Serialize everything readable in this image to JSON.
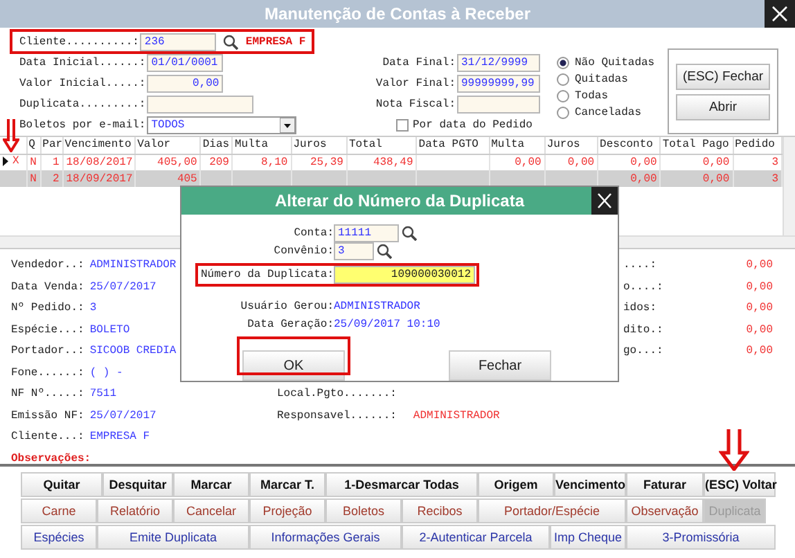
{
  "window": {
    "title": "Manutenção de Contas à Receber"
  },
  "filters": {
    "left": [
      {
        "label": "Cliente..........:",
        "value": "236",
        "kind": "search",
        "client_name": "EMPRESA F"
      },
      {
        "label": "Data Inicial......:",
        "value": "01/01/0001",
        "kind": "text"
      },
      {
        "label": "Valor Inicial.....:",
        "value": "0,00",
        "kind": "number"
      },
      {
        "label": "Duplicata.........:",
        "kind": "text"
      },
      {
        "label": "Boletos por e-mail:",
        "value": "TODOS",
        "kind": "select"
      }
    ],
    "right": [
      {
        "label": "Data Final:",
        "value": "31/12/9999"
      },
      {
        "label": "Valor Final:",
        "value": "99999999,99"
      },
      {
        "label": "Nota Fiscal:"
      }
    ],
    "checkbox": {
      "label": "Por data do Pedido",
      "checked": false
    },
    "radios": [
      {
        "label": "Não Quitadas",
        "selected": true
      },
      {
        "label": "Quitadas",
        "selected": false
      },
      {
        "label": "Todas",
        "selected": false
      },
      {
        "label": "Canceladas",
        "selected": false
      }
    ],
    "buttons": [
      "(ESC) Fechar",
      "Abrir"
    ]
  },
  "grid": {
    "columns": [
      null,
      "Q",
      "Par",
      "Vencimento",
      "Valor",
      "Dias",
      "Multa",
      "Juros",
      "Total",
      "Data PGTO",
      "Multa",
      "Juros",
      "Desconto",
      "Total Pago",
      "Pedido"
    ],
    "rows": [
      {
        "current": true,
        "selected": false,
        "cells": [
          "X",
          "N",
          "1",
          "18/08/2017",
          "405,00",
          "209",
          "8,10",
          "25,39",
          "438,49",
          null,
          "0,00",
          "0,00",
          "0,00",
          "0,00",
          "3"
        ]
      },
      {
        "current": false,
        "selected": true,
        "cells": [
          null,
          "N",
          "2",
          "18/09/2017",
          "405",
          null,
          null,
          null,
          null,
          null,
          null,
          null,
          "0,00",
          "0,00",
          "3"
        ]
      }
    ]
  },
  "details": {
    "left": [
      {
        "label": "Vendedor..:",
        "value": "ADMINISTRADOR",
        "kind": "field"
      },
      {
        "label": "Data Venda:",
        "value": "25/07/2017",
        "kind": "field"
      },
      {
        "label": "Nº Pedido.:",
        "value": "3",
        "kind": "field"
      },
      {
        "label": "Espécie...:",
        "value": "BOLETO",
        "kind": "field"
      },
      {
        "label": "Portador..:",
        "value": "SICOOB CREDIA",
        "kind": "field"
      },
      {
        "label": "Fone......:",
        "value": "(  )    -",
        "kind": "field"
      },
      {
        "label": "NF Nº.....:",
        "value": "7511",
        "kind": "field"
      },
      {
        "label": "Emissão NF:",
        "value": "25/07/2017",
        "kind": "field"
      },
      {
        "label": "Cliente...:",
        "value": "EMPRESA F",
        "kind": "field"
      },
      {
        "label": "Observações:",
        "kind": "note"
      }
    ],
    "middle": [
      {
        "label": "Local.Pgto.......:"
      },
      {
        "label": "Responsavel......:",
        "value": "ADMINISTRADOR"
      }
    ],
    "right": [
      {
        "label": "....:",
        "value": "0,00"
      },
      {
        "label": "o....:",
        "value": "0,00"
      },
      {
        "label": "idos:",
        "value": "0,00"
      },
      {
        "label": "dito.:",
        "value": "0,00"
      },
      {
        "label": "go...:",
        "value": "0,00"
      }
    ]
  },
  "actions": [
    {
      "kind": "primary",
      "buttons": [
        {
          "label": "Quitar",
          "disabled": false
        },
        {
          "label": "Desquitar",
          "disabled": false
        },
        {
          "label": "Marcar",
          "disabled": false
        },
        {
          "label": "Marcar T.",
          "disabled": false
        },
        {
          "label": "1-Desmarcar Todas",
          "disabled": false
        },
        {
          "label": "Origem",
          "disabled": false
        },
        {
          "label": "Vencimento",
          "disabled": false
        },
        {
          "label": "Faturar",
          "disabled": false
        },
        {
          "label": "(ESC) Voltar",
          "disabled": false
        }
      ]
    },
    {
      "kind": "secondary",
      "buttons": [
        {
          "label": "Carne",
          "disabled": false
        },
        {
          "label": "Relatório",
          "disabled": false
        },
        {
          "label": "Cancelar",
          "disabled": false
        },
        {
          "label": "Projeção",
          "disabled": false
        },
        {
          "label": "Boletos",
          "disabled": false
        },
        {
          "label": "Recibos",
          "disabled": false
        },
        {
          "label": "Portador/Espécie",
          "disabled": false
        },
        {
          "label": "Observação",
          "disabled": false
        },
        {
          "label": "Duplicata",
          "disabled": true
        }
      ]
    },
    {
      "kind": "tertiary",
      "buttons": [
        {
          "label": "Espécies",
          "disabled": false
        },
        {
          "label": "Emite Duplicata",
          "disabled": false
        },
        {
          "label": "Informações Gerais",
          "disabled": false
        },
        {
          "label": "2-Autenticar Parcela",
          "disabled": false
        },
        {
          "label": "Imp Cheque",
          "disabled": false
        },
        {
          "label": "3-Promissória",
          "disabled": false
        }
      ]
    }
  ],
  "dialog": {
    "title": "Alterar do Número da Duplicata",
    "fields": [
      {
        "label": "Conta:",
        "value": "11111",
        "kind": "search"
      },
      {
        "label": "Convênio:",
        "value": "3",
        "kind": "search"
      },
      {
        "label": "Número da Duplicata:",
        "value": "109000030012",
        "kind": "highlight"
      }
    ],
    "info": [
      {
        "label": "Usuário Gerou:",
        "value": "ADMINISTRADOR"
      },
      {
        "label": "Data Geração:",
        "value": "25/09/2017 10:10"
      }
    ],
    "buttons": [
      "OK",
      "Fechar"
    ]
  }
}
